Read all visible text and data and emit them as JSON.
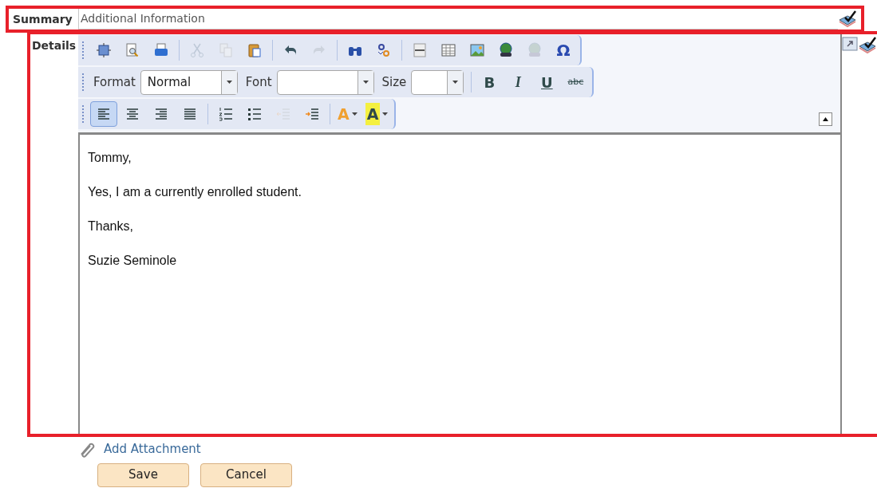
{
  "summary": {
    "label": "Summary",
    "value": "Additional Information"
  },
  "details": {
    "label": "Details",
    "toolbars": [
      {
        "items": [
          {
            "kind": "icon",
            "disabled": false
          },
          {
            "kind": "icon",
            "disabled": false
          },
          {
            "kind": "icon",
            "disabled": false
          },
          {
            "kind": "separator"
          },
          {
            "kind": "icon",
            "disabled": true
          },
          {
            "kind": "icon",
            "disabled": true
          },
          {
            "kind": "icon",
            "disabled": false
          },
          {
            "kind": "separator"
          },
          {
            "kind": "icon",
            "disabled": false
          },
          {
            "kind": "icon",
            "disabled": true
          },
          {
            "kind": "separator"
          },
          {
            "kind": "icon",
            "disabled": false
          },
          {
            "kind": "icon",
            "disabled": false
          },
          {
            "kind": "separator"
          },
          {
            "kind": "icon",
            "disabled": false
          },
          {
            "kind": "icon",
            "disabled": false
          },
          {
            "kind": "icon",
            "disabled": false
          },
          {
            "kind": "icon",
            "disabled": false
          },
          {
            "kind": "icon",
            "disabled": true
          },
          {
            "kind": "symbol",
            "text": "Ω",
            "disabled": false
          }
        ]
      },
      {
        "items": [
          {
            "kind": "label",
            "text": "Format"
          },
          {
            "kind": "combo",
            "value": "Normal"
          },
          {
            "kind": "label",
            "text": "Font"
          },
          {
            "kind": "combo"
          },
          {
            "kind": "label",
            "text": "Size"
          },
          {
            "kind": "smallcombo"
          },
          {
            "kind": "separator"
          },
          {
            "kind": "bold",
            "text": "B",
            "disabled": false
          },
          {
            "kind": "italic",
            "text": "I",
            "disabled": false
          },
          {
            "kind": "underline",
            "text": "U",
            "disabled": false
          },
          {
            "kind": "strike",
            "text": "abc",
            "disabled": false
          }
        ]
      },
      {
        "items": [
          {
            "kind": "icon",
            "selected": true,
            "disabled": false
          },
          {
            "kind": "icon",
            "selected": false,
            "disabled": false
          },
          {
            "kind": "icon",
            "selected": false,
            "disabled": false
          },
          {
            "kind": "icon",
            "selected": false,
            "disabled": false
          },
          {
            "kind": "separator"
          },
          {
            "kind": "icon",
            "selected": false,
            "disabled": false
          },
          {
            "kind": "icon",
            "selected": false,
            "disabled": false
          },
          {
            "kind": "icon",
            "selected": false,
            "disabled": true
          },
          {
            "kind": "icon",
            "selected": false,
            "disabled": false
          },
          {
            "kind": "separator"
          },
          {
            "kind": "text-color",
            "text": "A"
          },
          {
            "kind": "highlight",
            "text": "A"
          }
        ]
      }
    ],
    "paragraphs": [
      "Tommy,",
      "Yes, I am a currently enrolled student.",
      "Thanks,",
      "Suzie Seminole"
    ]
  },
  "attachment_link": "Add Attachment",
  "buttons": [
    "Save",
    "Cancel"
  ]
}
